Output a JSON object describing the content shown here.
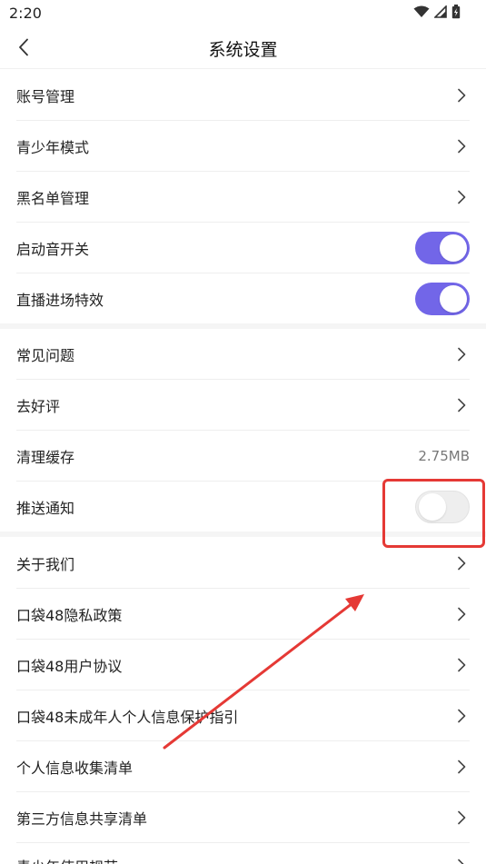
{
  "status_bar": {
    "time": "2:20"
  },
  "header": {
    "title": "系统设置"
  },
  "group1": [
    {
      "label": "账号管理",
      "type": "link"
    },
    {
      "label": "青少年模式",
      "type": "link"
    },
    {
      "label": "黑名单管理",
      "type": "link"
    },
    {
      "label": "启动音开关",
      "type": "toggle",
      "on": true
    },
    {
      "label": "直播进场特效",
      "type": "toggle",
      "on": true
    }
  ],
  "group2": [
    {
      "label": "常见问题",
      "type": "link"
    },
    {
      "label": "去好评",
      "type": "link"
    },
    {
      "label": "清理缓存",
      "type": "value",
      "value": "2.75MB"
    },
    {
      "label": "推送通知",
      "type": "toggle",
      "on": false
    }
  ],
  "group3": [
    {
      "label": "关于我们",
      "type": "link"
    },
    {
      "label": "口袋48隐私政策",
      "type": "link"
    },
    {
      "label": "口袋48用户协议",
      "type": "link"
    },
    {
      "label": "口袋48未成年人个人信息保护指引",
      "type": "link"
    },
    {
      "label": "个人信息收集清单",
      "type": "link"
    },
    {
      "label": "第三方信息共享清单",
      "type": "link"
    },
    {
      "label": "青少年使用规范",
      "type": "link"
    }
  ],
  "colors": {
    "toggle_on": "#7266e8",
    "toggle_off": "#eeeeee",
    "annotation": "#e53935"
  },
  "icons": {
    "back": "chevron-left-icon",
    "row": "chevron-right-icon",
    "wifi": "wifi-icon",
    "signal": "signal-icon",
    "battery": "battery-icon"
  }
}
